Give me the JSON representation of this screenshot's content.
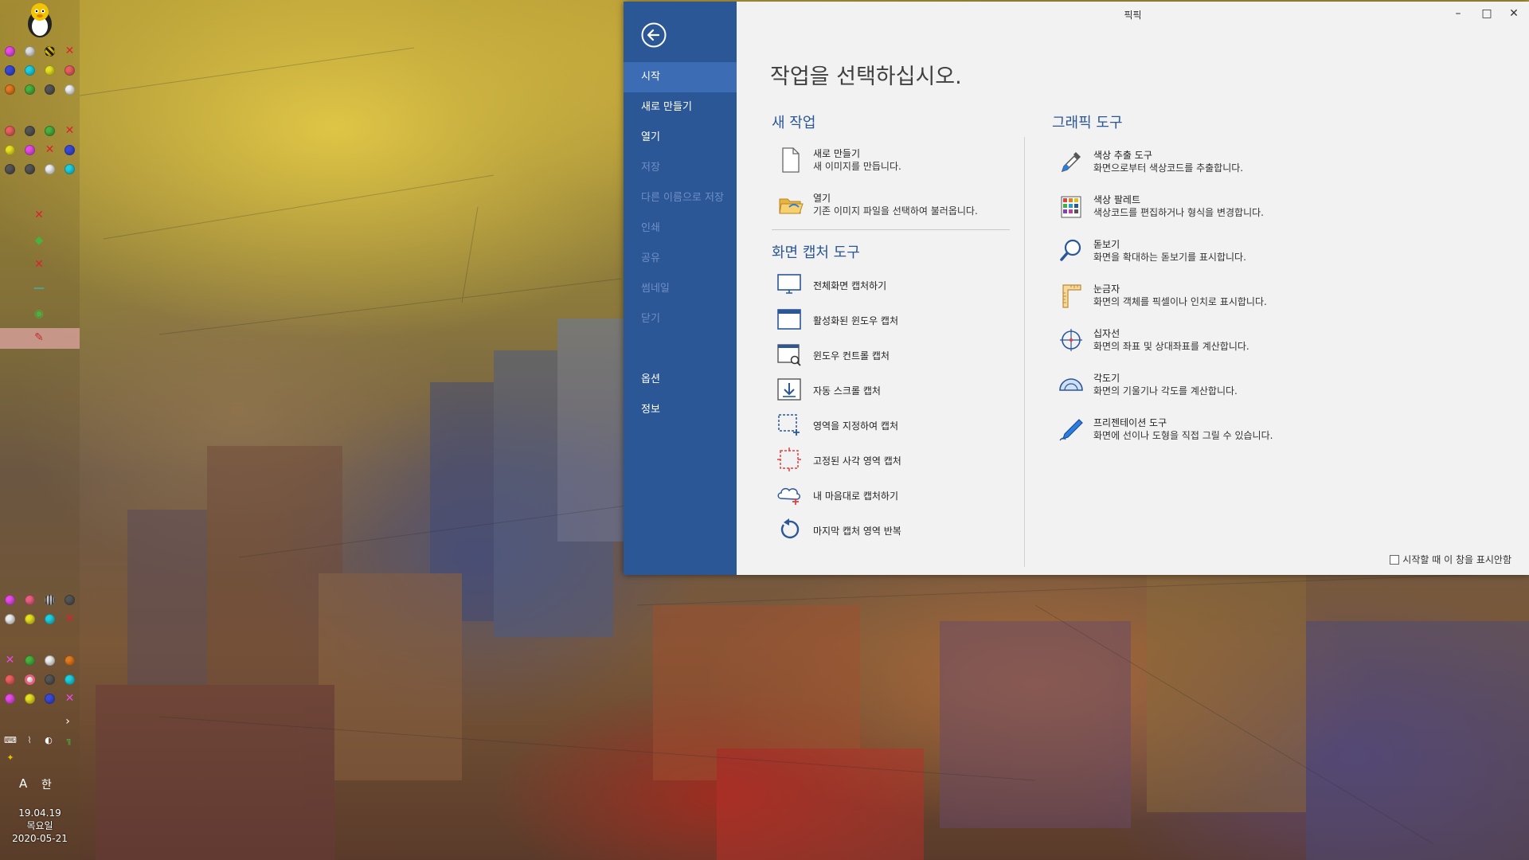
{
  "app": {
    "title": "픽픽",
    "heading": "작업을 선택하십시오.",
    "window_controls": {
      "minimize": "–",
      "maximize": "□",
      "close": "✕"
    }
  },
  "nav": {
    "items": [
      {
        "label": "시작",
        "state": "selected"
      },
      {
        "label": "새로 만들기",
        "state": "enabled"
      },
      {
        "label": "열기",
        "state": "enabled"
      },
      {
        "label": "저장",
        "state": "disabled"
      },
      {
        "label": "다른 이름으로 저장",
        "state": "disabled"
      },
      {
        "label": "인쇄",
        "state": "disabled"
      },
      {
        "label": "공유",
        "state": "disabled"
      },
      {
        "label": "썸네일",
        "state": "disabled"
      },
      {
        "label": "닫기",
        "state": "disabled"
      },
      {
        "label": "옵션",
        "state": "enabled"
      },
      {
        "label": "정보",
        "state": "enabled"
      }
    ]
  },
  "new_task": {
    "title": "새 작업",
    "items": [
      {
        "label": "새로 만들기",
        "desc": "새 이미지를 만듭니다.",
        "icon": "new-document-icon"
      },
      {
        "label": "열기",
        "desc": "기존 이미지 파일을 선택하여 불러옵니다.",
        "icon": "open-folder-icon"
      }
    ]
  },
  "capture": {
    "title": "화면 캡처 도구",
    "items": [
      {
        "label": "전체화면 캡처하기",
        "icon": "monitor-icon"
      },
      {
        "label": "활성화된 윈도우 캡처",
        "icon": "window-icon"
      },
      {
        "label": "윈도우 컨트롤 캡처",
        "icon": "window-search-icon"
      },
      {
        "label": "자동 스크롤 캡처",
        "icon": "scroll-down-icon"
      },
      {
        "label": "영역을 지정하여 캡처",
        "icon": "region-select-icon"
      },
      {
        "label": "고정된 사각 영역 캡처",
        "icon": "fixed-region-icon"
      },
      {
        "label": "내 마음대로 캡처하기",
        "icon": "freehand-cloud-icon"
      },
      {
        "label": "마지막 캡처 영역 반복",
        "icon": "repeat-icon"
      }
    ]
  },
  "graphic": {
    "title": "그래픽 도구",
    "items": [
      {
        "label": "색상 추출 도구",
        "desc": "화면으로부터 색상코드를 추출합니다.",
        "icon": "eyedropper-icon"
      },
      {
        "label": "색상 팔레트",
        "desc": "색상코드를 편집하거나 형식을 변경합니다.",
        "icon": "palette-grid-icon"
      },
      {
        "label": "돋보기",
        "desc": "화면을 확대하는 돋보기를 표시합니다.",
        "icon": "magnifier-icon"
      },
      {
        "label": "눈금자",
        "desc": "화면의 객체를 픽셀이나 인치로 표시합니다.",
        "icon": "ruler-icon"
      },
      {
        "label": "십자선",
        "desc": "화면의 좌표 및 상대좌표를 계산합니다.",
        "icon": "crosshair-icon"
      },
      {
        "label": "각도기",
        "desc": "화면의 기울기나 각도를 계산합니다.",
        "icon": "protractor-icon"
      },
      {
        "label": "프리젠테이션 도구",
        "desc": "화면에 선이나 도형을 직접 그릴 수 있습니다.",
        "icon": "pen-icon"
      }
    ]
  },
  "startup_checkbox": {
    "label": "시작할 때 이 창을 표시안함",
    "checked": false
  },
  "taskbar": {
    "ime_lang": "A",
    "ime_mode": "한",
    "time": "19.04.19",
    "weekday": "목요일",
    "date": "2020-05-21"
  },
  "colors": {
    "nav_bg": "#2b5797",
    "nav_selected": "#3c6cb4",
    "accent": "#2b5797",
    "content_bg": "#f2f2f2"
  }
}
